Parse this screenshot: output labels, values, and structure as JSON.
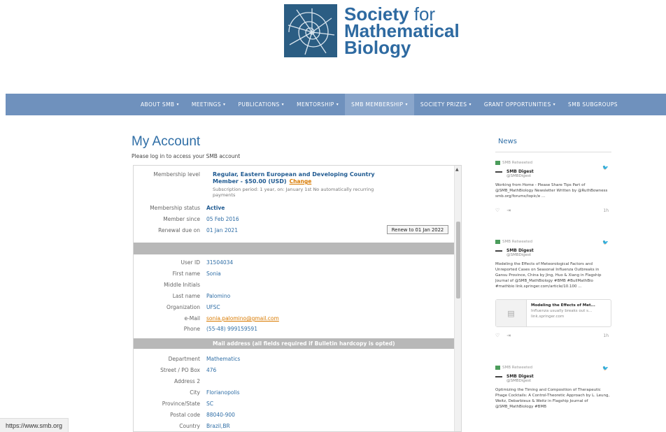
{
  "logo": {
    "line1": "Society",
    "line1b": "for",
    "line2": "Mathematical",
    "line3": "Biology"
  },
  "nav": [
    "ABOUT SMB",
    "MEETINGS",
    "PUBLICATIONS",
    "MENTORSHIP",
    "SMB MEMBERSHIP",
    "SOCIETY PRIZES",
    "GRANT OPPORTUNITIES",
    "SMB SUBGROUPS"
  ],
  "caret": "▾",
  "page": {
    "title": "My Account",
    "subtitle": "Please log in to access your SMB account"
  },
  "account": {
    "membership_level_label": "Membership level",
    "membership_level_value": "Regular, Eastern European and Developing Country Member - $50.00 (USD)",
    "change_label": "Change",
    "subscription_period": "Subscription period: 1 year, on: January 1st No automatically recurring payments",
    "status_label": "Membership status",
    "status_value": "Active",
    "since_label": "Member since",
    "since_value": "05 Feb 2016",
    "renewal_label": "Renewal due on",
    "renewal_value": "01 Jan 2021",
    "renew_button": "Renew to 01 Jan 2022",
    "user_id_label": "User ID",
    "user_id_value": "31504034",
    "first_name_label": "First name",
    "first_name_value": "Sonia",
    "middle_label": "Middle Initials",
    "last_name_label": "Last name",
    "last_name_value": "Palomino",
    "org_label": "Organization",
    "org_value": "UFSC",
    "email_label": "e-Mail",
    "email_value": "sonia.palomino@gmail.com",
    "phone_label": "Phone",
    "phone_value": "(55-48) 999159591",
    "mail_header": "Mail address (all fields required if Bulletin hardcopy is opted)",
    "dept_label": "Department",
    "dept_value": "Mathematics",
    "street_label": "Street / PO Box",
    "street_value": "476",
    "addr2_label": "Address 2",
    "city_label": "City",
    "city_value": "Florianopolis",
    "province_label": "Province/State",
    "province_value": "SC",
    "postal_label": "Postal code",
    "postal_value": "88040-900",
    "country_label": "Country",
    "country_value": "Brazil,BR"
  },
  "news": {
    "title": "News",
    "tweets": [
      {
        "retweeted": "SMB Retweeted",
        "author": "SMB Digest",
        "handle": "@SMBDigest",
        "text": "Working from Home - Please Share Tips Part of @SMB_MathBiology Newsletter Written by @RuthBowness smb.org/forums/topic/e ...",
        "time": "1h"
      },
      {
        "retweeted": "SMB Retweeted",
        "author": "SMB Digest",
        "handle": "@SMBDigest",
        "text": "Modeling the Effects of Meteorological Factors and Unreported Cases on Seasonal Influenza Outbreaks in Gansu Province, China by Jing, Huo & Xiang in Flagship Journal of @SMB_MathBiology #BMB #BullMathBio #mathbio link.springer.com/article/10.100 ...",
        "card_title": "Modeling the Effects of Met...",
        "card_sub": "Influenza usually breaks out s...",
        "card_domain": "link.springer.com",
        "time": "1h"
      },
      {
        "retweeted": "SMB Retweeted",
        "author": "SMB Digest",
        "handle": "@SMBDigest",
        "text": "Optimizing the Timing and Composition of Therapeutic Phage Cocktails: A Control-Theoretic Approach by L. Leung, Weitz, Debarbieux & Weitz in Flagship Journal of @SMB_MathBiology #BMB"
      }
    ]
  },
  "status_url": "https://www.smb.org",
  "colors": {
    "nav": "#6f91bd",
    "accent": "#2f6ea6",
    "orange": "#d97a00"
  }
}
